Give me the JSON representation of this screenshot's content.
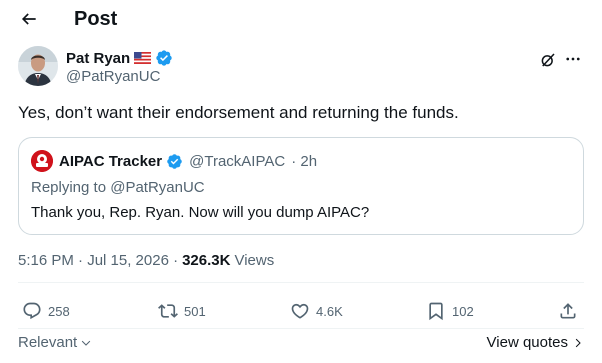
{
  "header": {
    "title": "Post"
  },
  "author": {
    "name": "Pat Ryan",
    "handle": "@PatRyanUC",
    "flag_icon": "us-flag-icon",
    "verified_color": "#1d9bf0"
  },
  "post": {
    "text": "Yes, don’t want their endorsement and returning the funds."
  },
  "quote": {
    "name": "AIPAC Tracker",
    "handle": "@TrackAIPAC",
    "time": "· 2h",
    "reply_prefix": "Replying to",
    "reply_mention": "@PatRyanUC",
    "text": "Thank you, Rep. Ryan. Now will you dump AIPAC?"
  },
  "meta": {
    "timestamp": "5:16 PM · Jul 15, 2026 ·",
    "views_count": "326.3K",
    "views_label": "Views"
  },
  "actions": {
    "replies": "258",
    "reposts": "501",
    "likes": "4.6K",
    "bookmarks": "102"
  },
  "footer": {
    "sort_label": "Relevant",
    "view_quotes_label": "View quotes"
  },
  "colors": {
    "text": "#0f1419",
    "secondary": "#536471",
    "border": "#cfd9de",
    "verified": "#1d9bf0",
    "aipac_red": "#d0121b"
  }
}
